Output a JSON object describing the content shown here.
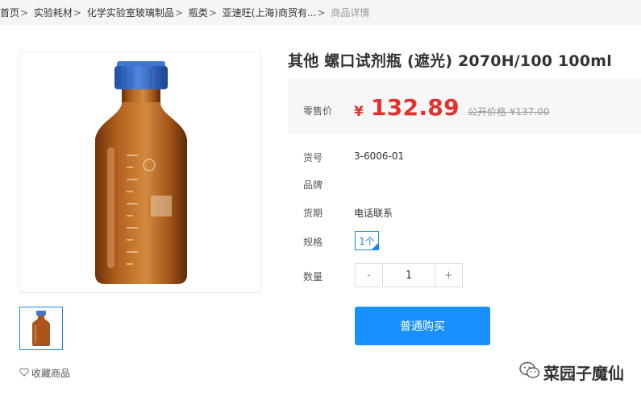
{
  "breadcrumb": {
    "items": [
      "首页",
      "实验耗材",
      "化学实验室玻璃制品",
      "瓶类",
      "亚速旺(上海)商贸有..."
    ],
    "separator": ">",
    "current": "商品详情"
  },
  "product": {
    "title": "其他 螺口试剂瓶 (遮光) 2070H/100 100ml",
    "price_label": "零售价",
    "currency_symbol": "¥",
    "price": "132.89",
    "original_price_label": "公开价格",
    "original_price": "¥137.00",
    "attributes": [
      {
        "label": "货号",
        "value": "3-6006-01"
      },
      {
        "label": "品牌",
        "value": ""
      },
      {
        "label": "货期",
        "value": "电话联系"
      }
    ],
    "spec_label": "规格",
    "spec_option": "1个",
    "qty_label": "数量",
    "qty_minus": "-",
    "qty_value": "1",
    "qty_plus": "+",
    "buy_button": "普通购买",
    "favorite": "收藏商品"
  },
  "watermark": "菜园子魔仙",
  "colors": {
    "price_red": "#e5302b",
    "accent_blue": "#1890ff",
    "bottle_amber": "#a9561c",
    "cap_blue": "#2a64c6"
  }
}
